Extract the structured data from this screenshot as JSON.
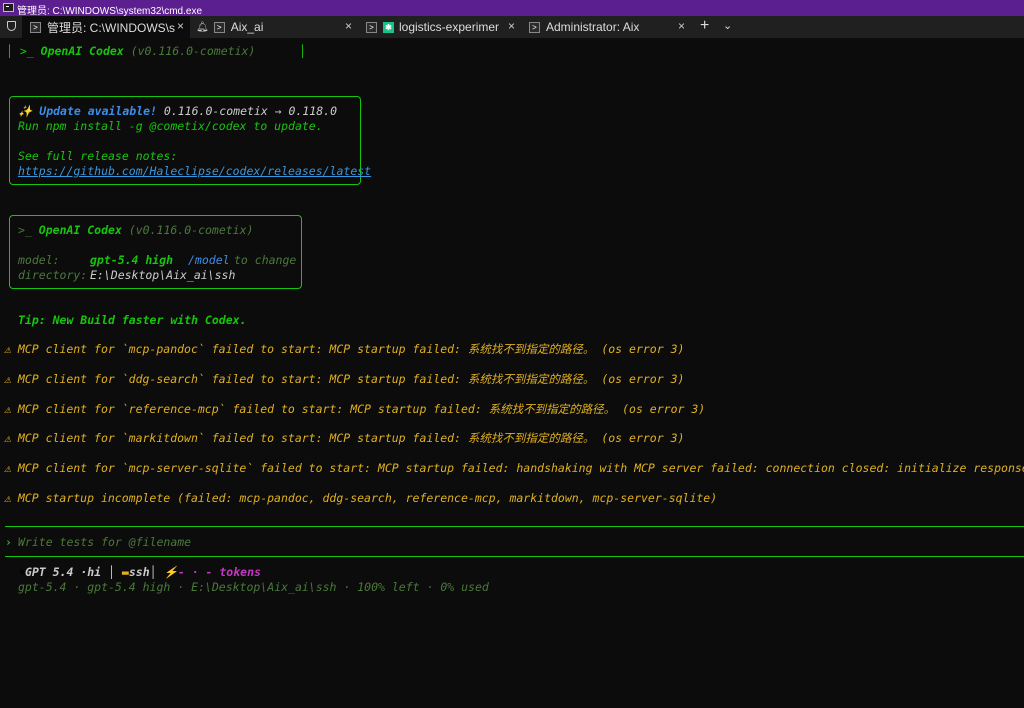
{
  "window": {
    "title": "管理员: C:\\WINDOWS\\system32\\cmd.exe"
  },
  "tabs": [
    {
      "label": "管理员: C:\\WINDOWS\\s",
      "icon": "terminal-icon"
    },
    {
      "label": "Aix_ai",
      "icon": "terminal-icon"
    },
    {
      "label": "logistics-experiment-",
      "icon": "codex-icon"
    },
    {
      "label": "Administrator: Aix",
      "icon": "terminal-icon"
    }
  ],
  "tabstrip": {
    "new_tab": "+",
    "dropdown": "⌄",
    "close": "×"
  },
  "terminal": {
    "banner_prompt": ">_",
    "banner_title": "OpenAI Codex",
    "banner_version": "(v0.116.0-cometix)",
    "update": {
      "sparkle": "✨",
      "line1_prefix": "Update available!",
      "line1_versions": "0.116.0-cometix → 0.118.0",
      "line2": "Run npm install -g @cometix/codex to update.",
      "line3": "See full release notes:",
      "link": "https://github.com/Haleclipse/codex/releases/latest"
    },
    "session": {
      "prompt": ">_",
      "title": "OpenAI Codex",
      "version": "(v0.116.0-cometix)",
      "model_label": "model:",
      "model_value": "gpt-5.4 high",
      "model_cmd": "/model",
      "model_hint": "to change",
      "dir_label": "directory:",
      "dir_value": "E:\\Desktop\\Aix_ai\\ssh"
    },
    "tip": "Tip: New Build faster with Codex.",
    "warnings": [
      "MCP client for `mcp-pandoc` failed to start: MCP startup failed: 系统找不到指定的路径。 (os error 3)",
      "MCP client for `ddg-search` failed to start: MCP startup failed: 系统找不到指定的路径。 (os error 3)",
      "MCP client for `reference-mcp` failed to start: MCP startup failed: 系统找不到指定的路径。 (os error 3)",
      "MCP client for `markitdown` failed to start: MCP startup failed: 系统找不到指定的路径。 (os error 3)",
      "MCP client for `mcp-server-sqlite` failed to start: MCP startup failed: handshaking with MCP server failed: connection closed: initialize response",
      "MCP startup incomplete (failed: mcp-pandoc, ddg-search, reference-mcp, markitdown, mcp-server-sqlite)"
    ],
    "warning_icon": "⚠",
    "input": {
      "chevron": "›",
      "placeholder": "Write tests for @filename"
    },
    "status": {
      "model_badge": "GPT 5.4 ·hi",
      "folder": "ssh",
      "tokens": "- · - tokens",
      "footer": "gpt-5.4 · gpt-5.4 high · E:\\Desktop\\Aix_ai\\ssh · 100% left · 0% used"
    }
  },
  "colors": {
    "titlebar": "#5c1f8f",
    "green": "#16c60c",
    "warning": "#e0b020",
    "accent_blue": "#3b8eea",
    "magenta": "#c336c3"
  }
}
